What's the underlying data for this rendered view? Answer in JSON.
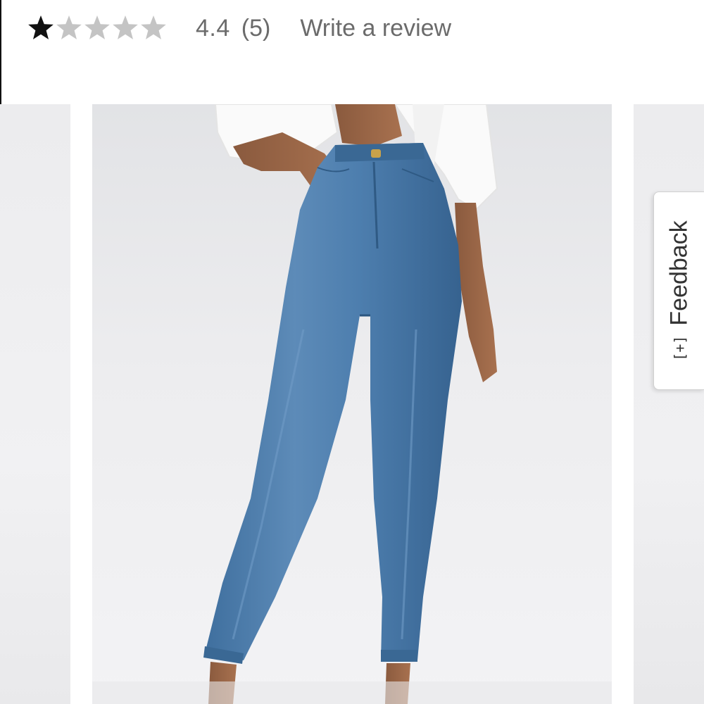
{
  "rating": {
    "value": 4.4,
    "value_text": "4.4",
    "max": 5,
    "count_text": "(5)",
    "write_review_label": "Write a review",
    "star_fill_color": "#111111",
    "star_empty_color": "#c4c4c4"
  },
  "carousel": {
    "slides": [
      {
        "icon": "product-photo-previous"
      },
      {
        "icon": "product-photo-high-waisted-jeans"
      },
      {
        "icon": "product-photo-next"
      }
    ]
  },
  "feedback": {
    "label": "Feedback",
    "icon_text": "[+]"
  },
  "colors": {
    "text_gray": "#6b6b6b",
    "denim": "#4a7bad",
    "background": "#ffffff"
  }
}
